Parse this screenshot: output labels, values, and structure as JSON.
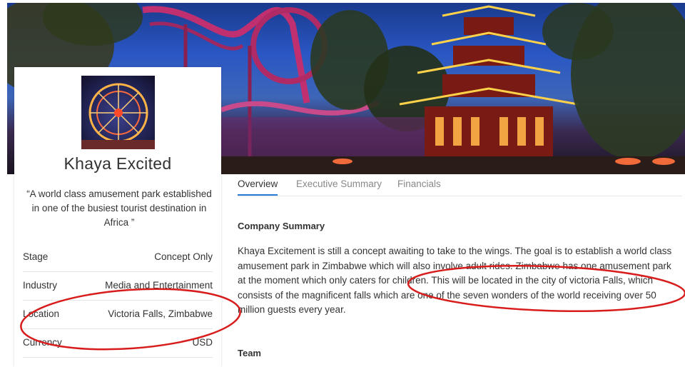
{
  "profile": {
    "name": "Khaya Excited",
    "tagline": "“A world class amusement park established in one of the busiest tourist destination in Africa ”",
    "details": [
      {
        "label": "Stage",
        "value": "Concept Only"
      },
      {
        "label": "Industry",
        "value": "Media and Entertainment"
      },
      {
        "label": "Location",
        "value": "Victoria Falls, Zimbabwe"
      },
      {
        "label": "Currency",
        "value": "USD"
      }
    ]
  },
  "tabs": [
    {
      "label": "Overview",
      "active": true
    },
    {
      "label": "Executive Summary",
      "active": false
    },
    {
      "label": "Financials",
      "active": false
    }
  ],
  "company_summary": {
    "title": "Company Summary",
    "text": "Khaya Excitement is still a concept awaiting to take to the wings. The goal is to establish a world class amusement park in Zimbabwe which will also involve adult rides. Zimbabwe has one amusement park at the moment which only caters for children. This will be located in the city of victoria Falls, which consists of the magnificent falls which are one of the seven wonders of the world receiving over 50 million guests every year."
  },
  "team": {
    "title": "Team"
  },
  "colors": {
    "accent": "#2a7bd5",
    "annotation": "#d81c1c"
  }
}
